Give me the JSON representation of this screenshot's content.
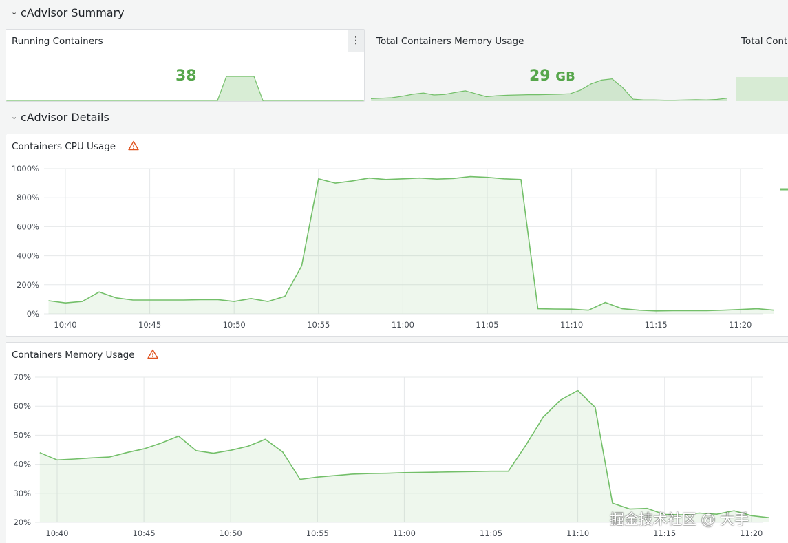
{
  "rows": {
    "summary": {
      "title": "cAdvisor Summary"
    },
    "details": {
      "title": "cAdvisor Details"
    }
  },
  "stats": [
    {
      "title": "Running Containers",
      "value": "38",
      "unit": "",
      "sparkline": [
        0,
        0,
        0,
        0,
        0,
        0,
        0,
        0,
        0,
        0,
        0,
        0,
        0,
        0,
        0,
        0,
        0,
        0,
        0,
        0,
        0,
        0,
        0,
        0,
        1,
        1,
        1,
        1,
        0,
        0,
        0,
        0,
        0,
        0,
        0,
        0,
        0,
        0,
        0,
        0
      ]
    },
    {
      "title": "Total Containers Memory Usage",
      "value": "29",
      "unit": "GB",
      "sparkline": [
        0.1,
        0.12,
        0.14,
        0.2,
        0.28,
        0.33,
        0.25,
        0.27,
        0.35,
        0.42,
        0.3,
        0.18,
        0.22,
        0.24,
        0.25,
        0.26,
        0.26,
        0.27,
        0.28,
        0.3,
        0.45,
        0.7,
        0.85,
        0.9,
        0.55,
        0.08,
        0.05,
        0.05,
        0.04,
        0.04,
        0.05,
        0.06,
        0.05,
        0.07,
        0.12
      ]
    },
    {
      "title": "Total Cont"
    }
  ],
  "colors": {
    "series": "#73bf69",
    "stat": "#56a64b",
    "grid": "#e6e8ea",
    "warn": "#e0531f"
  },
  "icons": {
    "menu": "⋮",
    "chevron": "⌄",
    "warning": "warning-icon"
  },
  "x_ticks": [
    "10:40",
    "10:45",
    "10:50",
    "10:55",
    "11:00",
    "11:05",
    "11:10",
    "11:15",
    "11:20"
  ],
  "chart_data": [
    {
      "type": "area",
      "title": "Containers CPU Usage",
      "y_ticks": [
        "1000%",
        "800%",
        "600%",
        "400%",
        "200%",
        "0%"
      ],
      "ylim": [
        0,
        1000
      ],
      "x_start": "10:39",
      "x_step_minutes": 1,
      "values": [
        90,
        75,
        85,
        150,
        110,
        95,
        95,
        95,
        95,
        97,
        98,
        85,
        105,
        85,
        120,
        330,
        930,
        900,
        915,
        935,
        925,
        930,
        935,
        928,
        932,
        945,
        940,
        930,
        925,
        35,
        33,
        32,
        25,
        78,
        35,
        25,
        20,
        22,
        22,
        22,
        25,
        30,
        35,
        25
      ]
    },
    {
      "type": "area",
      "title": "Containers Memory Usage",
      "y_ticks": [
        "70%",
        "60%",
        "50%",
        "40%",
        "30%",
        "20%"
      ],
      "ylim": [
        20,
        70
      ],
      "x_start": "10:39",
      "x_step_minutes": 1,
      "values": [
        44,
        41.5,
        41.8,
        42.2,
        42.5,
        44,
        45.3,
        47.3,
        49.7,
        44.7,
        43.8,
        44.8,
        46.2,
        48.6,
        44.2,
        34.8,
        35.6,
        36.1,
        36.6,
        36.8,
        36.9,
        37.1,
        37.2,
        37.3,
        37.4,
        37.5,
        37.6,
        37.6,
        46.5,
        56.2,
        62.1,
        65.4,
        59.6,
        26.6,
        24.6,
        24.8,
        22.7,
        22.6,
        23.2,
        22.8,
        24.0,
        22.3,
        21.6
      ]
    }
  ],
  "watermark": "掘金技术社区 @ 大手"
}
